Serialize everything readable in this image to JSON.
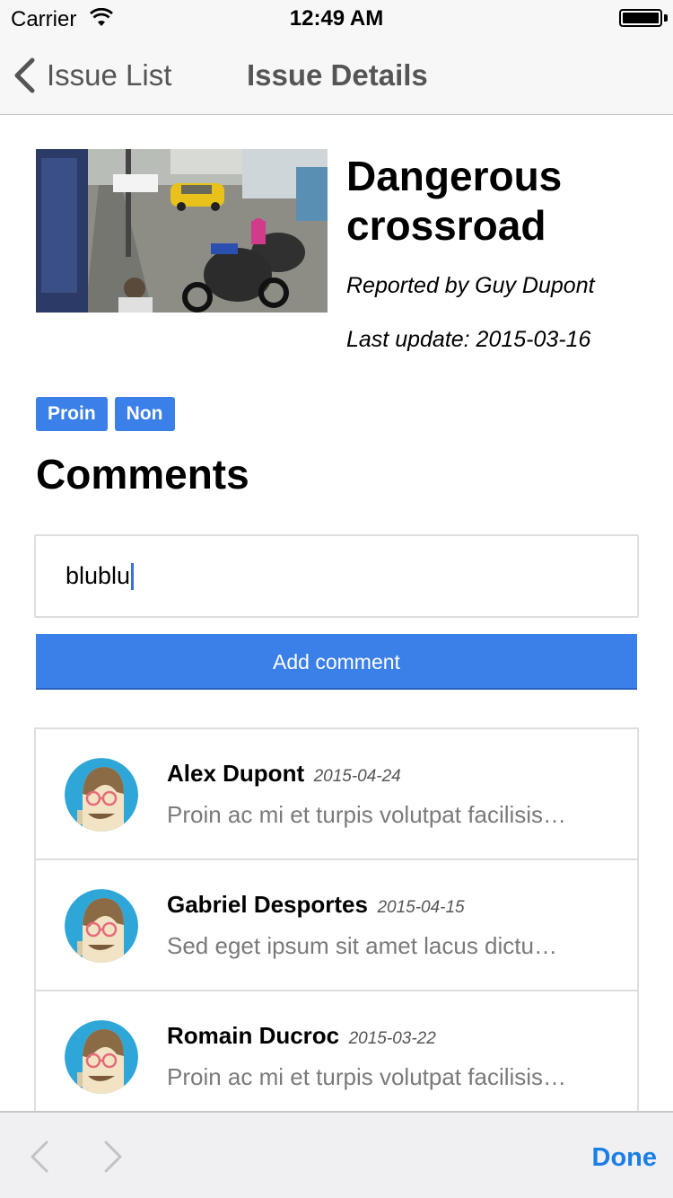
{
  "status_bar": {
    "carrier": "Carrier",
    "time": "12:49 AM"
  },
  "nav": {
    "back_label": "Issue List",
    "title": "Issue Details"
  },
  "issue": {
    "title": "Dangerous crossroad",
    "reporter": "Reported by Guy Dupont",
    "updated": "Last update: 2015-03-16",
    "tags": [
      "Proin",
      "Non"
    ]
  },
  "comments_heading": "Comments",
  "comment_input": {
    "value": "blublu"
  },
  "add_comment_label": "Add comment",
  "comments": [
    {
      "author": "Alex Dupont",
      "date": "2015-04-24",
      "text": "Proin ac mi et turpis volutpat facilisis…"
    },
    {
      "author": "Gabriel Desportes",
      "date": "2015-04-15",
      "text": "Sed eget ipsum sit amet lacus dictu…"
    },
    {
      "author": "Romain Ducroc",
      "date": "2015-03-22",
      "text": "Proin ac mi et turpis volutpat facilisis…"
    }
  ],
  "toolbar": {
    "done_label": "Done"
  },
  "colors": {
    "accent": "#3b7fe8",
    "done": "#1a7ee6",
    "avatar_bg": "#2fa6d8"
  }
}
